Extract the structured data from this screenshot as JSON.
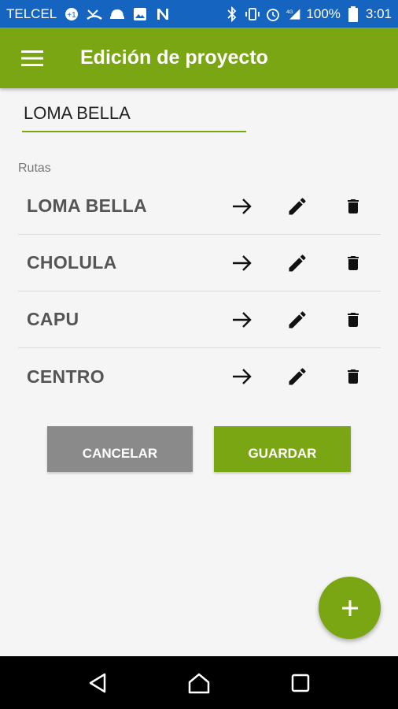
{
  "status_bar": {
    "carrier": "TELCEL",
    "battery": "100%",
    "time": "3:01",
    "network": "4G"
  },
  "app_bar": {
    "title": "Edición de proyecto",
    "menu_icon": "hamburger-menu-icon"
  },
  "project": {
    "name_value": "LOMA BELLA"
  },
  "routes_section": {
    "label": "Rutas",
    "items": [
      {
        "name": "LOMA BELLA"
      },
      {
        "name": "CHOLULA"
      },
      {
        "name": "CAPU"
      },
      {
        "name": "CENTRO"
      }
    ]
  },
  "actions": {
    "cancel_label": "CANCELAR",
    "save_label": "GUARDAR"
  },
  "colors": {
    "accent": "#7aa614",
    "status_bar": "#1565c0",
    "cancel": "#8a8a8a"
  }
}
